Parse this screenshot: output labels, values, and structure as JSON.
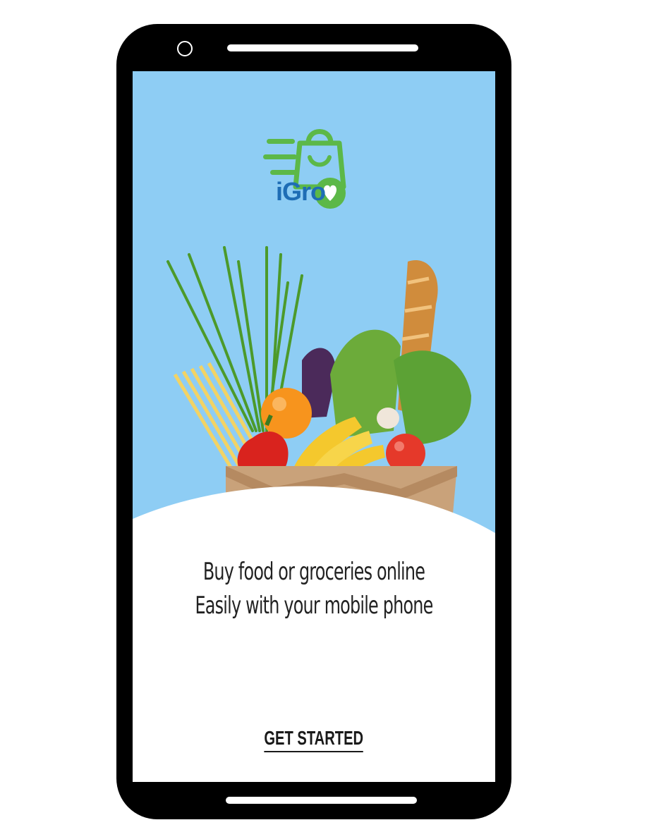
{
  "app": {
    "logo_text": "iGro",
    "brand_colors": {
      "green": "#5cb848",
      "blue": "#1e6db5",
      "sky": "#8ecdf4"
    }
  },
  "onboarding": {
    "headline_line1": "Buy food or groceries online",
    "headline_line2": "Easily with your mobile phone",
    "cta_label": "GET STARTED"
  },
  "hero": {
    "image_icon": "grocery-bag-illustration"
  }
}
